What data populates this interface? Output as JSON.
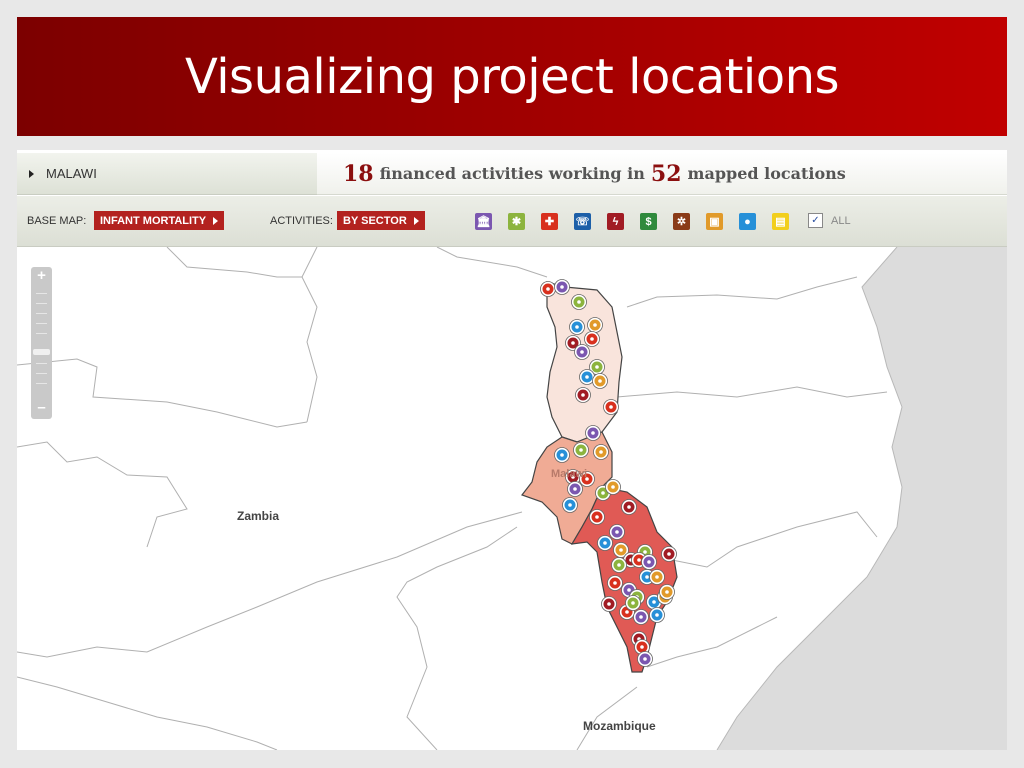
{
  "slide": {
    "title": "Visualizing project locations"
  },
  "app": {
    "country": "MALAWI",
    "headline": {
      "activities_count": "18",
      "activities_text": "financed activities working in",
      "locations_count": "52",
      "locations_text": "mapped locations"
    },
    "toolbar": {
      "base_map_label": "BASE MAP:",
      "base_map_value": "INFANT MORTALITY",
      "activities_label": "ACTIVITIES:",
      "activities_value": "BY SECTOR",
      "all_label": "ALL",
      "all_checked": true,
      "sectors": [
        {
          "icon": "bank-icon",
          "color": "#7b57b0",
          "glyph": "🏛"
        },
        {
          "icon": "agriculture-icon",
          "color": "#8cb43e",
          "glyph": "✱"
        },
        {
          "icon": "health-cross-icon",
          "color": "#d8301e",
          "glyph": "✚"
        },
        {
          "icon": "phone-icon",
          "color": "#1c5fa8",
          "glyph": "☏"
        },
        {
          "icon": "energy-icon",
          "color": "#a11c24",
          "glyph": "ϟ"
        },
        {
          "icon": "finance-dollar-icon",
          "color": "#2f8a3c",
          "glyph": "$"
        },
        {
          "icon": "industry-gear-icon",
          "color": "#8a3b18",
          "glyph": "✲"
        },
        {
          "icon": "transport-bus-icon",
          "color": "#e19a2a",
          "glyph": "▣"
        },
        {
          "icon": "water-drop-icon",
          "color": "#2690d8",
          "glyph": "●"
        },
        {
          "icon": "education-book-icon",
          "color": "#f2cf1d",
          "glyph": "▤"
        }
      ]
    },
    "map": {
      "labels": {
        "zambia": "Zambia",
        "malawi": "Malawi",
        "mozambique": "Mozambique"
      },
      "zoom_in": "+",
      "zoom_out": "–",
      "regions": {
        "north": {
          "infant_mortality_class": "low",
          "color": "#f9e4dc"
        },
        "central": {
          "infant_mortality_class": "medium",
          "color": "#f0ab95"
        },
        "south": {
          "infant_mortality_class": "high",
          "color": "#e05a55"
        }
      },
      "markers": [
        {
          "sector": "water",
          "color": "#2690d8"
        },
        {
          "sector": "transport",
          "color": "#e19a2a"
        },
        {
          "sector": "energy",
          "color": "#a11c24"
        },
        {
          "sector": "health",
          "color": "#d8301e"
        },
        {
          "sector": "bank",
          "color": "#7b57b0"
        },
        {
          "sector": "agriculture",
          "color": "#8cb43e"
        }
      ]
    }
  }
}
